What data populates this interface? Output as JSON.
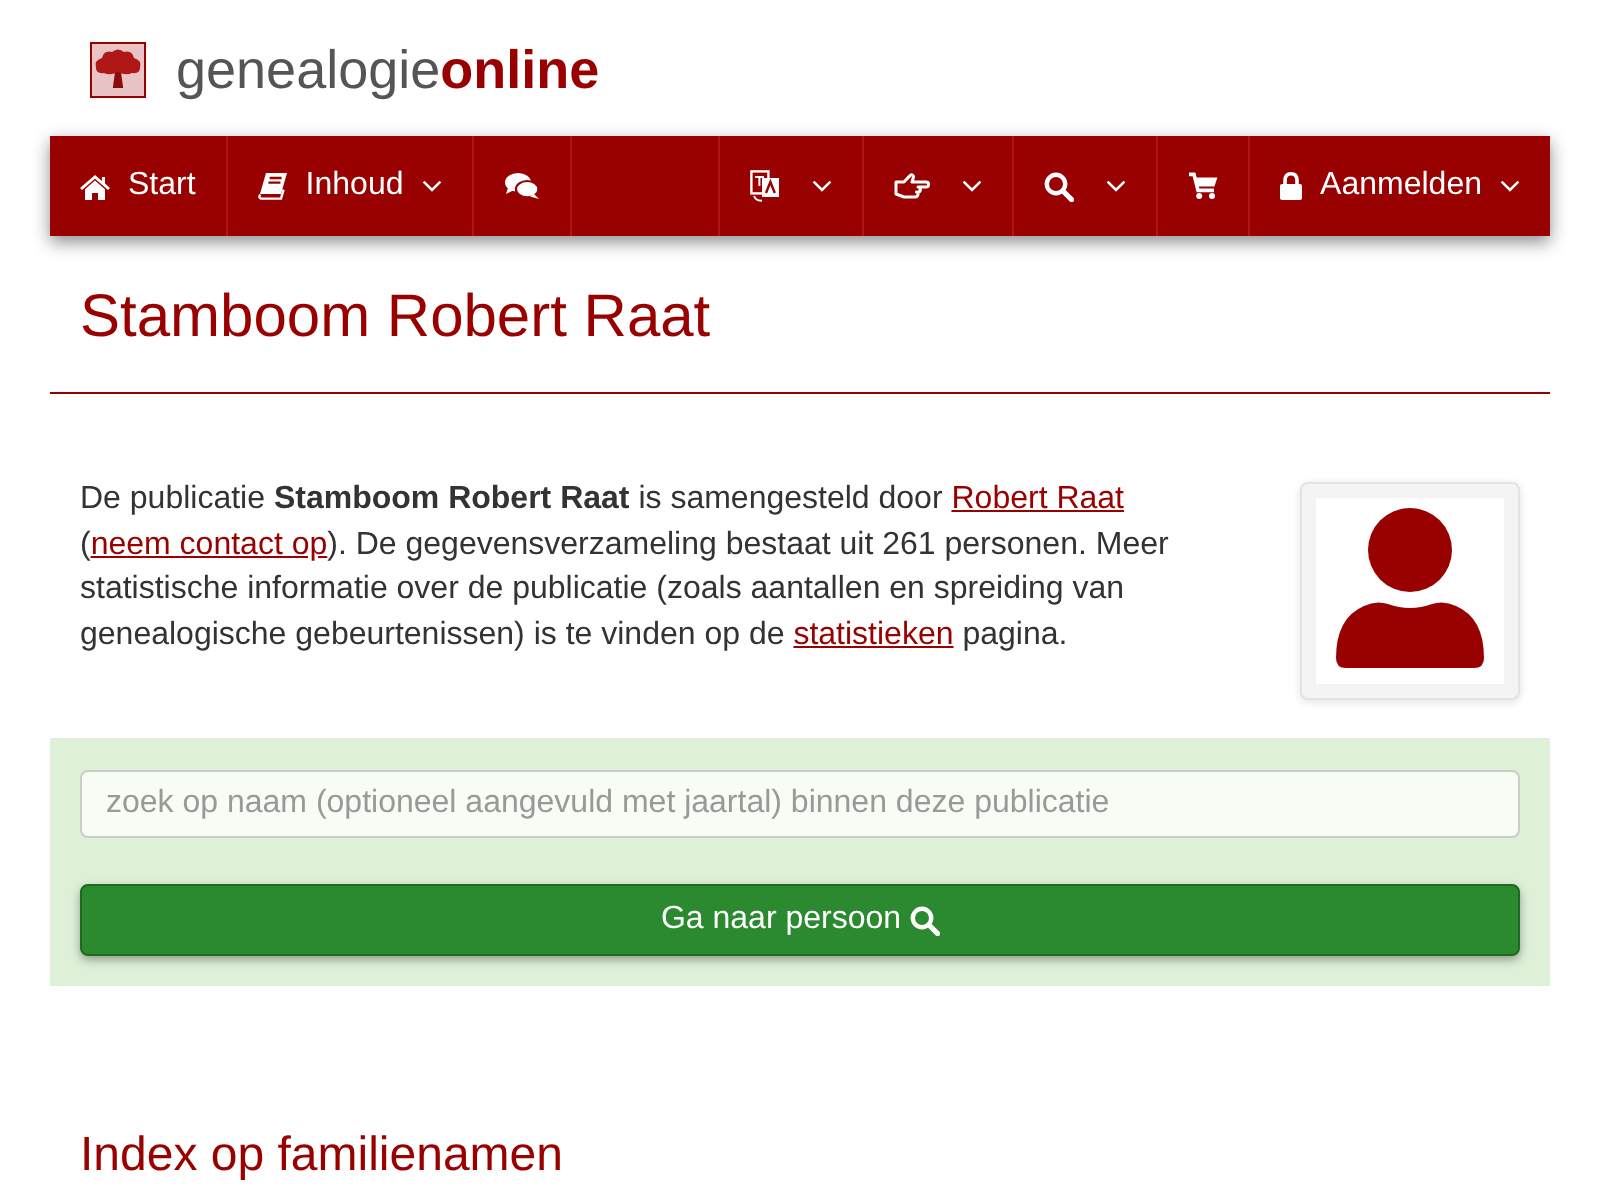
{
  "logo": {
    "text": "genealogie**online**"
  },
  "nav": {
    "left": [
      {
        "label": "Start",
        "dropdown": false
      },
      {
        "label": "Inhoud",
        "dropdown": true
      },
      {
        "dropdown": false
      }
    ],
    "right": [
      {
        "dropdown": true
      },
      {
        "dropdown": true
      },
      {
        "dropdown": true
      },
      {
        "dropdown": false
      },
      {
        "label": "Aanmelden",
        "dropdown": true
      }
    ]
  },
  "title": "Stamboom Robert Raat",
  "intro": [
    {
      "kind": "text",
      "text": "De publicatie **Stamboom Robert Raat** is samengesteld door "
    },
    {
      "kind": "link",
      "text": "Robert Raat"
    },
    {
      "kind": "text",
      "text": " ("
    },
    {
      "kind": "link",
      "text": "neem contact op"
    },
    {
      "kind": "text",
      "text": "). De gegevensverzameling bestaat uit 261 personen. Meer statistische informatie over de publicatie (zoals aantallen en spreiding van genealogische gebeurtenissen) is te vinden op de "
    },
    {
      "kind": "link",
      "text": "statistieken"
    },
    {
      "kind": "text",
      "text": " pagina."
    }
  ],
  "search": {
    "placeholder": "zoek op naam (optioneel aangevuld met jaartal) binnen deze publicatie",
    "button": "Ga naar persoon"
  },
  "section_heading": "Index op familienamen"
}
